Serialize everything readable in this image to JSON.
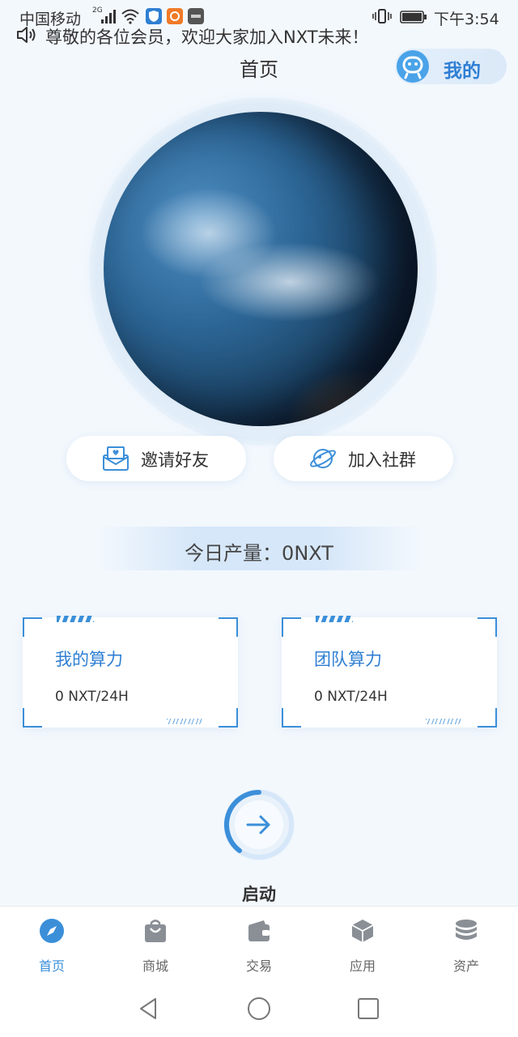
{
  "status_bar": {
    "carrier": "中国移动",
    "network": "2G",
    "time": "下午3:54"
  },
  "notice": {
    "text": "尊敬的各位会员，欢迎大家加入NXT未来！"
  },
  "header": {
    "title": "首页",
    "mine_label": "我的"
  },
  "actions": [
    {
      "label": "邀请好友",
      "icon": "invite-envelope-icon"
    },
    {
      "label": "加入社群",
      "icon": "planet-ring-icon"
    }
  ],
  "production": {
    "text": "今日产量：0NXT"
  },
  "power_cards": [
    {
      "title": "我的算力",
      "value": "0 NXT/24H"
    },
    {
      "title": "团队算力",
      "value": "0 NXT/24H"
    }
  ],
  "start": {
    "label": "启动",
    "icon": "arrow-right-icon"
  },
  "tabs": [
    {
      "label": "首页",
      "icon": "compass-icon",
      "active": true
    },
    {
      "label": "商城",
      "icon": "shopping-bag-icon",
      "active": false
    },
    {
      "label": "交易",
      "icon": "wallet-icon",
      "active": false
    },
    {
      "label": "应用",
      "icon": "cube-icon",
      "active": false
    },
    {
      "label": "资产",
      "icon": "coin-stack-icon",
      "active": false
    }
  ],
  "colors": {
    "accent": "#3b8fd9",
    "background": "#f3f8fd"
  }
}
